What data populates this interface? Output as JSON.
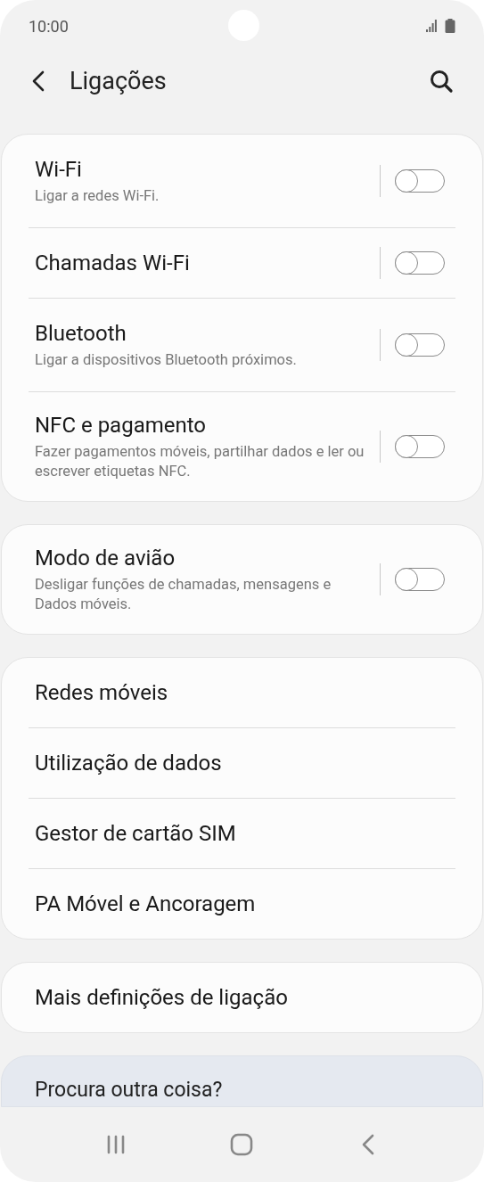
{
  "status_bar": {
    "time": "10:00"
  },
  "header": {
    "title": "Ligações"
  },
  "groups": [
    {
      "items": [
        {
          "kind": "toggle",
          "title": "Wi-Fi",
          "subtitle": "Ligar a redes Wi-Fi.",
          "on": false
        },
        {
          "kind": "toggle",
          "title": "Chamadas Wi-Fi",
          "on": false
        },
        {
          "kind": "toggle",
          "title": "Bluetooth",
          "subtitle": "Ligar a dispositivos Bluetooth próximos.",
          "on": false
        },
        {
          "kind": "toggle",
          "title": "NFC e pagamento",
          "subtitle": "Fazer pagamentos móveis, partilhar dados e ler ou escrever etiquetas NFC.",
          "on": false
        }
      ]
    },
    {
      "items": [
        {
          "kind": "toggle",
          "title": "Modo de avião",
          "subtitle": "Desligar funções de chamadas, mensagens e Dados móveis.",
          "on": false
        }
      ]
    },
    {
      "items": [
        {
          "kind": "link",
          "title": "Redes móveis"
        },
        {
          "kind": "link",
          "title": "Utilização de dados"
        },
        {
          "kind": "link",
          "title": "Gestor de cartão SIM"
        },
        {
          "kind": "link",
          "title": "PA Móvel e Ancoragem"
        }
      ]
    },
    {
      "items": [
        {
          "kind": "link",
          "title": "Mais definições de ligação"
        }
      ]
    }
  ],
  "suggestion": {
    "title": "Procura outra coisa?"
  }
}
